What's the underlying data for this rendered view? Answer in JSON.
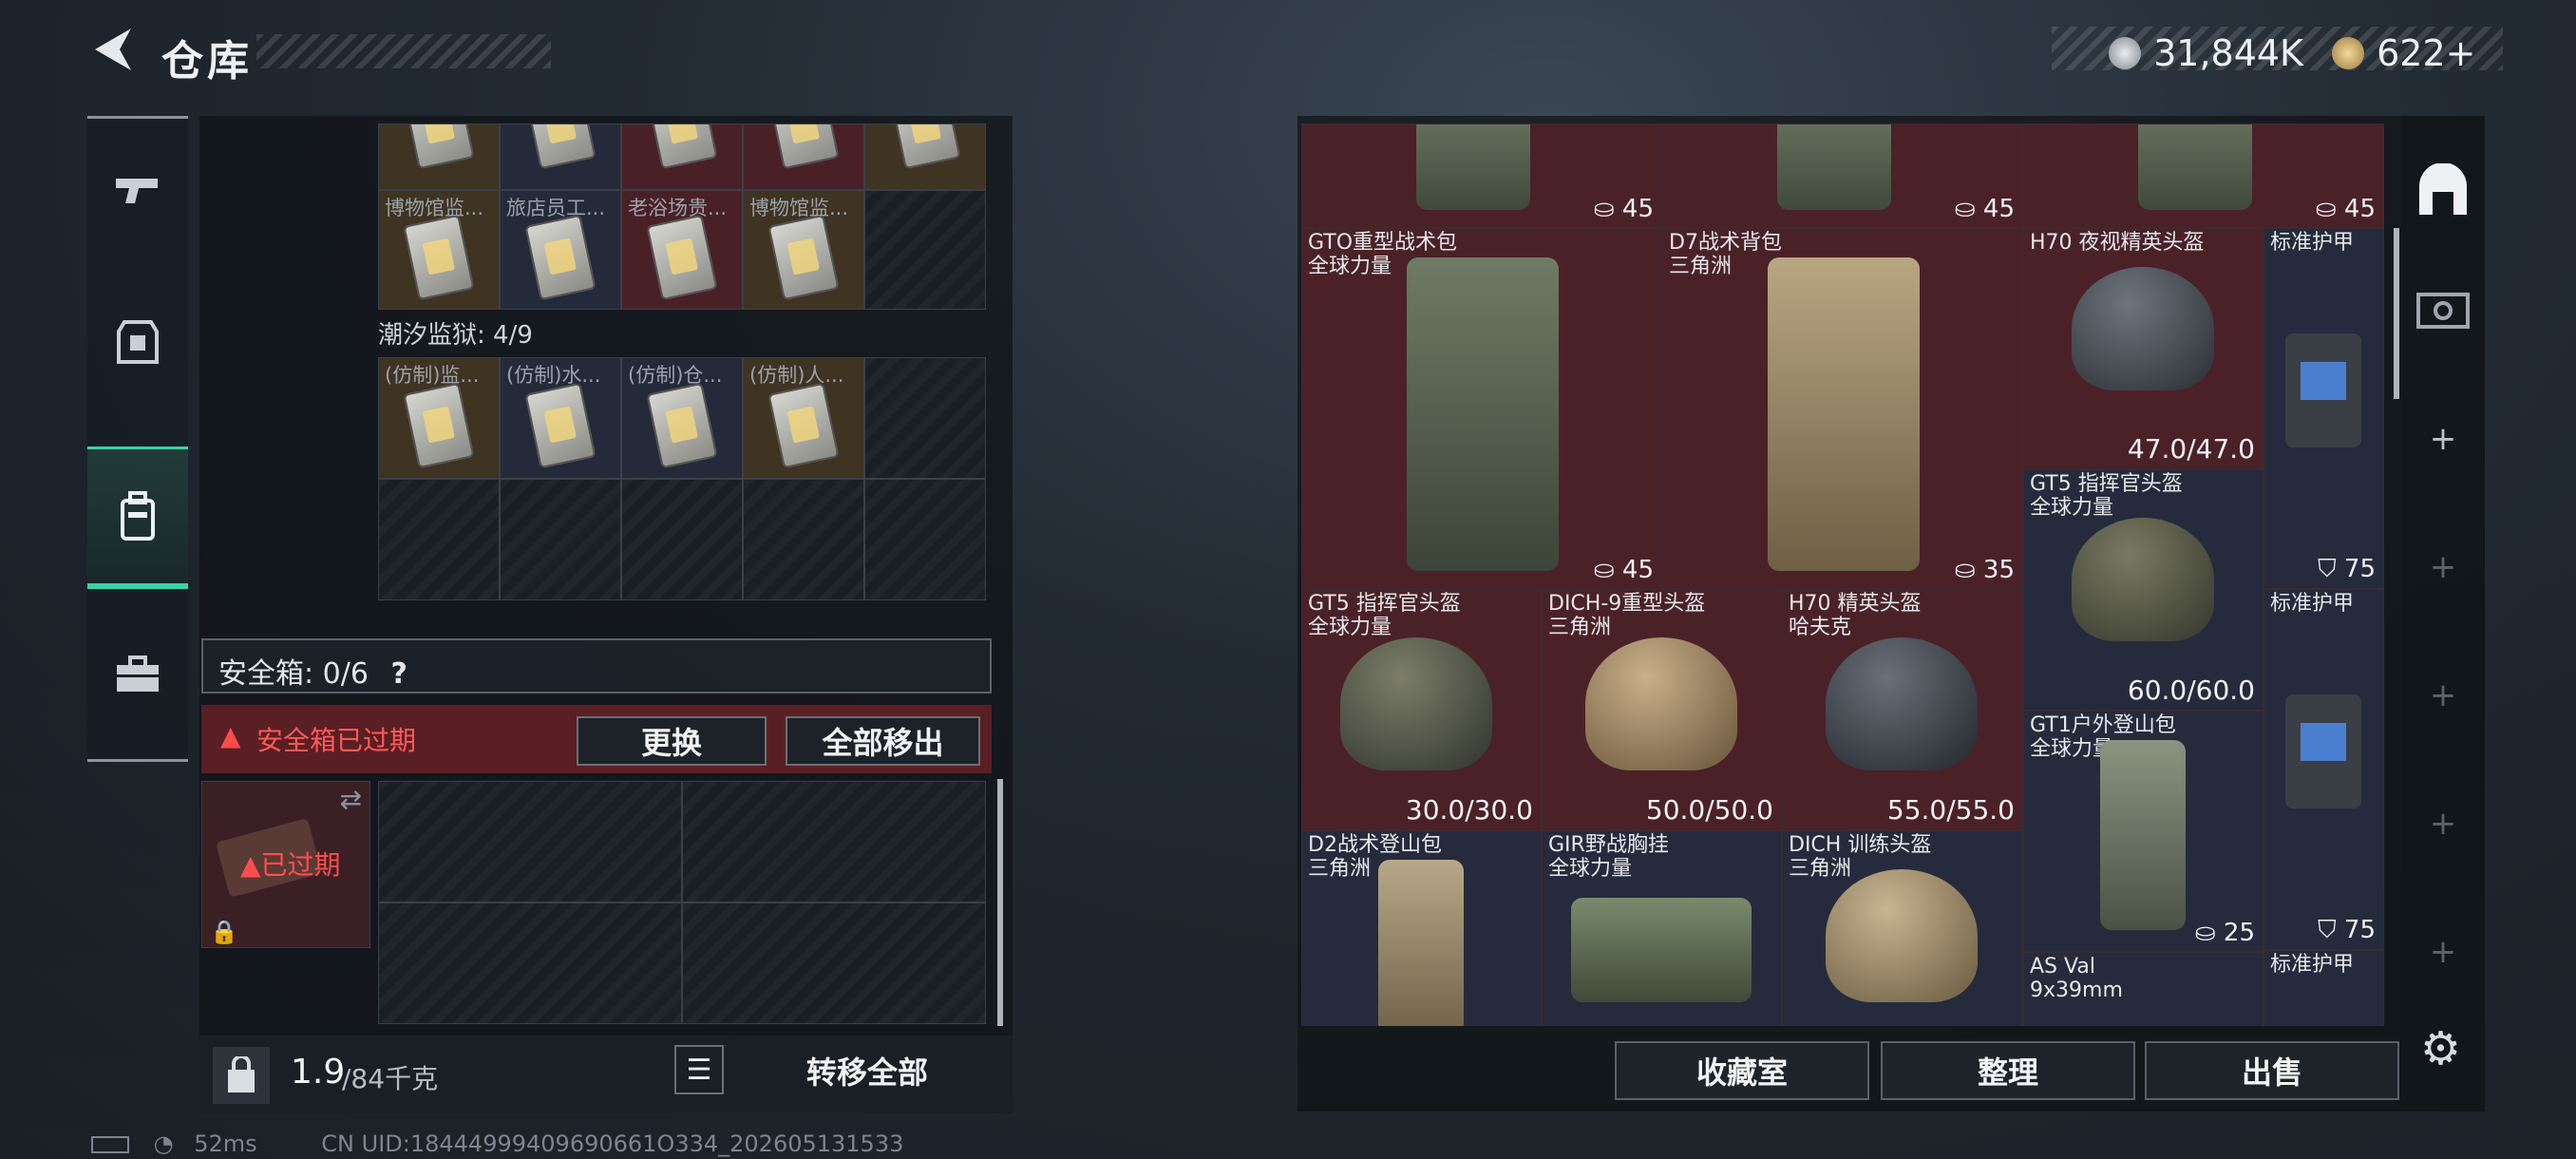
{
  "header": {
    "title": "仓库",
    "currency1": "31,844K",
    "currency2": "622+"
  },
  "sidebar": {
    "items": [
      "gun-icon",
      "armor-icon",
      "backpack-icon",
      "briefcase-icon"
    ]
  },
  "left": {
    "top_labels": [
      "博物馆监...",
      "旅店员工...",
      "老浴场贵...",
      "博物馆监..."
    ],
    "section_label": "潮汐监狱: 4/9",
    "section_labels": [
      "(仿制)监...",
      "(仿制)水...",
      "(仿制)仓...",
      "(仿制)人..."
    ],
    "safebox": "安全箱: 0/6",
    "safebox_help": "?",
    "expired_text": "安全箱已过期",
    "replace_btn": "更换",
    "move_all_btn": "全部移出",
    "expired_badge": "已过期",
    "weight": "1.9",
    "weight_cap": "/84千克",
    "transfer_all": "转移全部"
  },
  "items": [
    {
      "name": "",
      "sub": "",
      "val": "45"
    },
    {
      "name": "",
      "sub": "",
      "val": "45"
    },
    {
      "name": "",
      "sub": "",
      "val": "45"
    },
    {
      "name": "GTO重型战术包",
      "sub": "全球力量",
      "val": "45"
    },
    {
      "name": "D7战术背包",
      "sub": "三角洲",
      "val": "35"
    },
    {
      "name": "H70 夜视精英头盔",
      "sub": "",
      "val": "47.0/47.0"
    },
    {
      "name": "标准护甲",
      "sub": "",
      "val": "75"
    },
    {
      "name": "GT5 指挥官头盔",
      "sub": "全球力量",
      "val": "60.0/60.0"
    },
    {
      "name": "GT5 指挥官头盔",
      "sub": "全球力量",
      "val": "30.0/30.0"
    },
    {
      "name": "DICH-9重型头盔",
      "sub": "三角洲",
      "val": "50.0/50.0"
    },
    {
      "name": "H70 精英头盔",
      "sub": "哈夫克",
      "val": "55.0/55.0"
    },
    {
      "name": "标准护甲",
      "sub": "",
      "val": "75"
    },
    {
      "name": "GT1户外登山包",
      "sub": "全球力量",
      "val": "25"
    },
    {
      "name": "D2战术登山包",
      "sub": "三角洲",
      "val": ""
    },
    {
      "name": "GIR野战胸挂",
      "sub": "全球力量",
      "val": ""
    },
    {
      "name": "DICH 训练头盔",
      "sub": "三角洲",
      "val": ""
    },
    {
      "name": "AS Val",
      "sub": "9x39mm",
      "val": ""
    },
    {
      "name": "标准护甲",
      "sub": "",
      "val": ""
    }
  ],
  "bottom": {
    "btn1": "收藏室",
    "btn2": "整理",
    "btn3": "出售"
  },
  "status": {
    "ping": "52ms",
    "uid": "CN UID:18444999409690661O334_202605131533"
  }
}
